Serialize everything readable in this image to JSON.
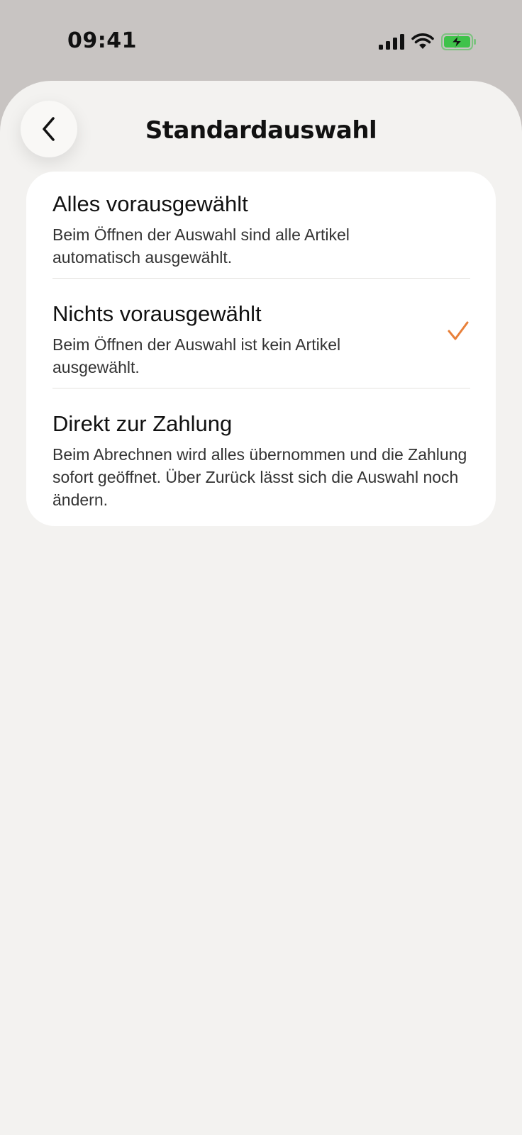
{
  "status_bar": {
    "time": "09:41",
    "icons": [
      "cellular-signal-icon",
      "wifi-icon",
      "battery-charging-icon"
    ],
    "battery_color": "#3fc24a"
  },
  "header": {
    "title": "Standardauswahl",
    "back_icon": "chevron-left-icon"
  },
  "options": [
    {
      "title": "Alles vorausgewählt",
      "description": "Beim Öffnen der Auswahl sind alle Artikel automatisch ausgewählt.",
      "selected": false
    },
    {
      "title": "Nichts vorausgewählt",
      "description": "Beim Öffnen der Auswahl ist kein Artikel ausgewählt.",
      "selected": true
    },
    {
      "title": "Direkt zur Zahlung",
      "description": "Beim Abrechnen wird alles übernommen und die Zahlung sofort geöffnet. Über Zurück lässt sich die Auswahl noch ändern.",
      "selected": false
    }
  ],
  "colors": {
    "accent": "#e8803a",
    "sheet_background": "#f3f2f0",
    "status_background": "#c8c4c2"
  }
}
